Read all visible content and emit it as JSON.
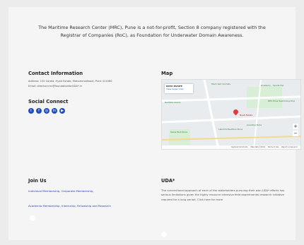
{
  "intro": {
    "text": "The Maritime Research Center (MRC), Pune is a not-for-profit, Section 8 company registered with the Registrar of Companies (RoC), as Foundation for Underwater Domain Awareness."
  },
  "contact": {
    "heading": "Contact Information",
    "address": "Address: 102 Cordia, Hyati Estate, Mohammedwadi, Pune 411060",
    "email": "Email: director.mrc@foundationforUDA*.in"
  },
  "social": {
    "heading": "Social Connect",
    "icons": [
      "twitter-icon",
      "facebook-icon",
      "instagram-icon",
      "linkedin-icon",
      "youtube-icon"
    ],
    "accent": "#1f4fbf"
  },
  "map": {
    "heading": "Map",
    "info_title": "NYATI ESTATE",
    "info_link": "View larger map",
    "pin_label": "Nyati Estate",
    "labels": [
      "Mont Vert Orchids",
      "Academy - Sports Fac",
      "DPS Pune Swimming Pool",
      "Radhika Lawns",
      "Anantraj Pune",
      "Lakshmi Realtors Pune",
      "Oasis Park Pune"
    ],
    "zoom_in": "+",
    "zoom_out": "−",
    "footer": [
      "Keyboard shortcuts",
      "Map data ©2024",
      "Terms of Use",
      "Report a map error"
    ]
  },
  "join": {
    "heading": "Join Us",
    "link1": "Individual Membership, Corporate Membership,",
    "link2": "Academia Membership, Internship, Fellowship and Research"
  },
  "uda": {
    "heading": "UDA*",
    "text": "The conventional approach of each of the stakeholders pursuing their own UDA* efforts has serious limitations given the highly resource intensive field experimental research initiative required for a long period. Click here for more"
  },
  "colors": {
    "link": "#1f3fbf",
    "pin": "#e03c3c"
  }
}
